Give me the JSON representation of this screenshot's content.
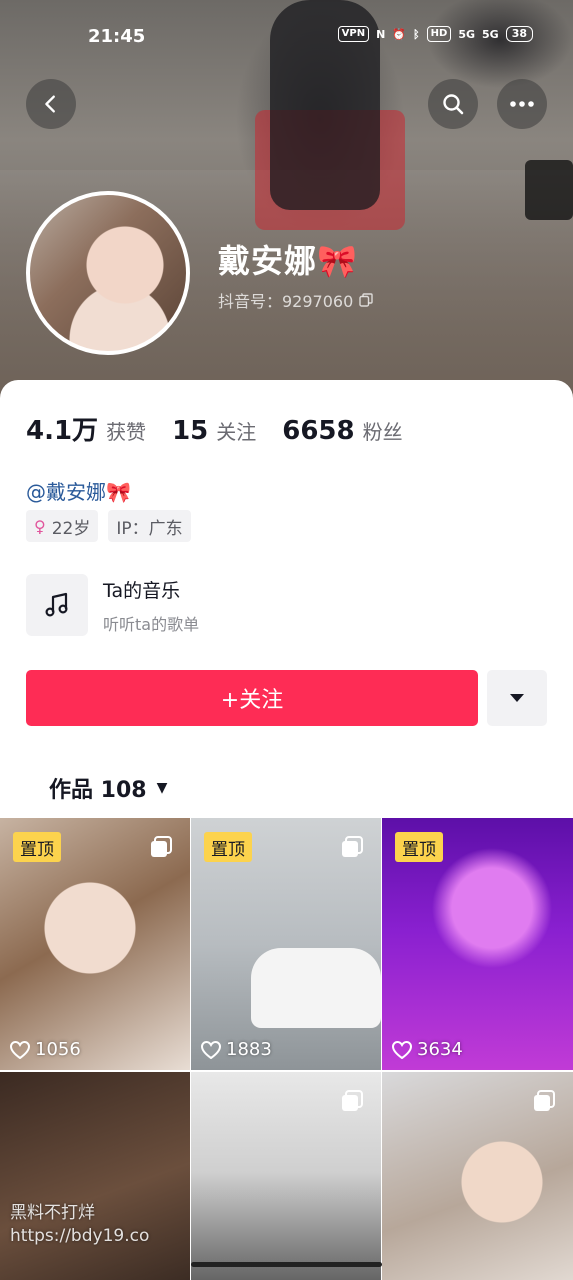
{
  "status_bar": {
    "time": "21:45",
    "vpn": "VPN",
    "network_1": "5G",
    "network_2": "5G",
    "hd": "HD",
    "battery": "38"
  },
  "profile": {
    "nickname": "戴安娜🎀",
    "douyin_id": "抖音号：9297060",
    "handle": "@戴安娜🎀",
    "tags": {
      "age": "22岁",
      "ip": "IP：广东"
    }
  },
  "stats": [
    {
      "num": "4.1万",
      "label": "获赞"
    },
    {
      "num": "15",
      "label": "关注"
    },
    {
      "num": "6658",
      "label": "粉丝"
    }
  ],
  "music": {
    "title": "Ta的音乐",
    "subtitle": "听听ta的歌单"
  },
  "actions": {
    "follow": "+关注"
  },
  "works_tab": {
    "label": "作品 108"
  },
  "videos": [
    {
      "pinned": "置顶",
      "likes": "1056"
    },
    {
      "pinned": "置顶",
      "likes": "1883"
    },
    {
      "pinned": "置顶",
      "likes": "3634"
    },
    {
      "pinned": "",
      "likes": ""
    },
    {
      "pinned": "",
      "likes": ""
    },
    {
      "pinned": "",
      "likes": ""
    }
  ],
  "watermark": {
    "line1": "黑料不打烊",
    "line2": "https://bdy19.co"
  },
  "icons": {
    "back": "chevron-left-icon",
    "search": "search-icon",
    "more": "more-dots-icon",
    "copy": "copy-icon",
    "music": "music-note-icon",
    "dropdown": "caret-down-icon",
    "heart": "heart-icon",
    "multi": "multi-image-icon"
  },
  "colors": {
    "accent": "#fe2c55",
    "pin_badge": "#fcd34d",
    "handle": "#2a5a9a"
  }
}
